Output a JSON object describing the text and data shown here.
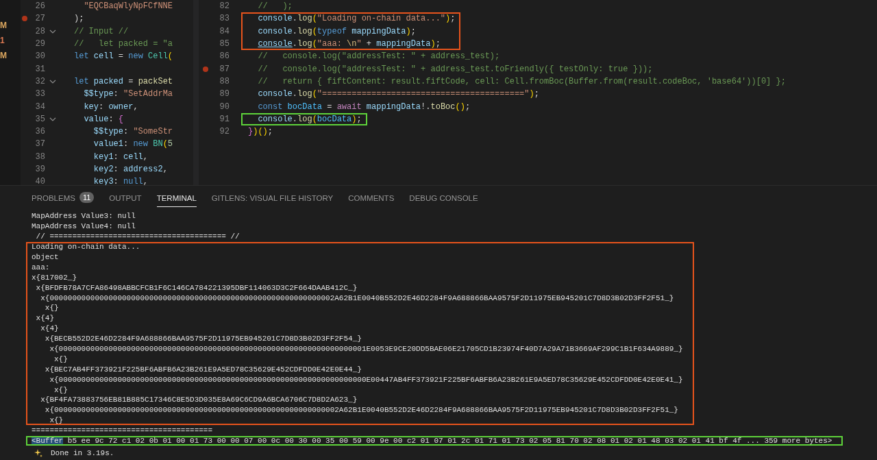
{
  "explorer_badges": [
    {
      "text": "M",
      "color": "#d9a55e"
    },
    {
      "text": "1",
      "color": "#e07b53"
    },
    {
      "text": "M",
      "color": "#d9a55e"
    }
  ],
  "left_editor": {
    "lines": [
      {
        "kind": "line",
        "number": "26",
        "breakpoint": false,
        "tokens": [
          {
            "kind": "str",
            "text": "  \"EQCBaqWlyNpFCfNNE"
          }
        ]
      },
      {
        "kind": "line",
        "number": "27",
        "breakpoint": true,
        "tokens": [
          {
            "kind": "p",
            "text": ");"
          }
        ]
      },
      {
        "kind": "line",
        "number": "28",
        "breakpoint": false,
        "expanded": true,
        "tokens": [
          {
            "kind": "cm",
            "text": "// Input //"
          }
        ]
      },
      {
        "kind": "line",
        "number": "29",
        "breakpoint": false,
        "tokens": [
          {
            "kind": "cm",
            "text": "//   let packed = \"a"
          }
        ]
      },
      {
        "kind": "line",
        "number": "30",
        "breakpoint": false,
        "tokens": [
          {
            "kind": "kw",
            "text": "let"
          },
          {
            "kind": "var",
            "text": " cell"
          },
          {
            "kind": "p",
            "text": " = "
          },
          {
            "kind": "kw",
            "text": "new"
          },
          {
            "kind": "type",
            "text": " Cell"
          },
          {
            "kind": "br",
            "text": "("
          }
        ]
      },
      {
        "kind": "line",
        "number": "31",
        "breakpoint": false
      },
      {
        "kind": "line",
        "number": "32",
        "breakpoint": false,
        "expanded": true,
        "tokens": [
          {
            "kind": "kw",
            "text": "let"
          },
          {
            "kind": "var",
            "text": " packed"
          },
          {
            "kind": "p",
            "text": " = "
          },
          {
            "kind": "fn",
            "text": "packSet"
          }
        ]
      },
      {
        "kind": "line",
        "number": "33",
        "breakpoint": false,
        "tokens": [
          {
            "kind": "var",
            "text": "  $$type"
          },
          {
            "kind": "p",
            "text": ": "
          },
          {
            "kind": "str",
            "text": "\"SetAddrMa"
          }
        ]
      },
      {
        "kind": "line",
        "number": "34",
        "breakpoint": false,
        "tokens": [
          {
            "kind": "var",
            "text": "  key"
          },
          {
            "kind": "p",
            "text": ": "
          },
          {
            "kind": "var",
            "text": "owner"
          },
          {
            "kind": "p",
            "text": ","
          }
        ]
      },
      {
        "kind": "line",
        "number": "35",
        "breakpoint": false,
        "expanded": true,
        "tokens": [
          {
            "kind": "var",
            "text": "  value"
          },
          {
            "kind": "p",
            "text": ": "
          },
          {
            "kind": "br2",
            "text": "{"
          }
        ]
      },
      {
        "kind": "line",
        "number": "36",
        "breakpoint": false,
        "tokens": [
          {
            "kind": "var",
            "text": "    $$type"
          },
          {
            "kind": "p",
            "text": ": "
          },
          {
            "kind": "str",
            "text": "\"SomeStr"
          }
        ]
      },
      {
        "kind": "line",
        "number": "37",
        "breakpoint": false,
        "tokens": [
          {
            "kind": "var",
            "text": "    value1"
          },
          {
            "kind": "p",
            "text": ": "
          },
          {
            "kind": "kw",
            "text": "new"
          },
          {
            "kind": "type",
            "text": " BN"
          },
          {
            "kind": "br",
            "text": "("
          },
          {
            "kind": "num",
            "text": "5"
          }
        ]
      },
      {
        "kind": "line",
        "number": "38",
        "breakpoint": false,
        "tokens": [
          {
            "kind": "var",
            "text": "    key1"
          },
          {
            "kind": "p",
            "text": ": "
          },
          {
            "kind": "var",
            "text": "cell"
          },
          {
            "kind": "p",
            "text": ","
          }
        ]
      },
      {
        "kind": "line",
        "number": "39",
        "breakpoint": false,
        "tokens": [
          {
            "kind": "var",
            "text": "    key2"
          },
          {
            "kind": "p",
            "text": ": "
          },
          {
            "kind": "var",
            "text": "address2"
          },
          {
            "kind": "p",
            "text": ","
          }
        ]
      },
      {
        "kind": "line",
        "number": "40",
        "breakpoint": false,
        "tokens": [
          {
            "kind": "var",
            "text": "    key3"
          },
          {
            "kind": "p",
            "text": ": "
          },
          {
            "kind": "kw",
            "text": "null"
          },
          {
            "kind": "p",
            "text": ","
          }
        ]
      }
    ]
  },
  "right_editor": {
    "lines": [
      {
        "kind": "line",
        "number": "82",
        "breakpoint": false,
        "tokens": [
          {
            "kind": "cm",
            "text": "  //   );"
          }
        ]
      },
      {
        "kind": "annotation",
        "color": "#e8541c",
        "lines": [
          {
            "kind": "line",
            "number": "83",
            "breakpoint": false,
            "tokens": [
              {
                "kind": "var",
                "text": "  console"
              },
              {
                "kind": "p",
                "text": "."
              },
              {
                "kind": "fn",
                "text": "log"
              },
              {
                "kind": "br",
                "text": "("
              },
              {
                "kind": "str",
                "text": "\"Loading on-chain data...\""
              },
              {
                "kind": "br",
                "text": ")"
              },
              {
                "kind": "p",
                "text": ";"
              }
            ]
          },
          {
            "kind": "line",
            "number": "84",
            "breakpoint": false,
            "tokens": [
              {
                "kind": "var",
                "text": "  console"
              },
              {
                "kind": "p",
                "text": "."
              },
              {
                "kind": "fn",
                "text": "log"
              },
              {
                "kind": "br",
                "text": "("
              },
              {
                "kind": "kw",
                "text": "typeof"
              },
              {
                "kind": "var",
                "text": " mappingData"
              },
              {
                "kind": "br",
                "text": ")"
              },
              {
                "kind": "p",
                "text": ";"
              }
            ]
          },
          {
            "kind": "line",
            "number": "85",
            "breakpoint": false,
            "tokens": [
              {
                "kind": "var",
                "text": "  console",
                "underline": true
              },
              {
                "kind": "p",
                "text": "."
              },
              {
                "kind": "fn",
                "text": "log"
              },
              {
                "kind": "br",
                "text": "("
              },
              {
                "kind": "str",
                "text": "\"aaa: "
              },
              {
                "kind": "esc",
                "text": "\\n"
              },
              {
                "kind": "str",
                "text": "\""
              },
              {
                "kind": "p",
                "text": " + "
              },
              {
                "kind": "var",
                "text": "mappingData"
              },
              {
                "kind": "br",
                "text": ")"
              },
              {
                "kind": "p",
                "text": ";"
              }
            ]
          }
        ]
      },
      {
        "kind": "line",
        "number": "86",
        "breakpoint": false,
        "tokens": [
          {
            "kind": "cm",
            "text": "  //   console.log(\"addressTest: \" + address_test);"
          }
        ]
      },
      {
        "kind": "line",
        "number": "87",
        "breakpoint": true,
        "tokens": [
          {
            "kind": "cm",
            "text": "  //   console.log(\"addressTest: \" + address_test.toFriendly({ testOnly: true }));"
          }
        ]
      },
      {
        "kind": "line",
        "number": "88",
        "breakpoint": false,
        "tokens": [
          {
            "kind": "cm",
            "text": "  //   return { fiftContent: result.fiftCode, cell: Cell.fromBoc(Buffer.from(result.codeBoc, 'base64'))[0] };"
          }
        ]
      },
      {
        "kind": "line",
        "number": "89",
        "breakpoint": false,
        "tokens": [
          {
            "kind": "var",
            "text": "  console"
          },
          {
            "kind": "p",
            "text": "."
          },
          {
            "kind": "fn",
            "text": "log"
          },
          {
            "kind": "br",
            "text": "("
          },
          {
            "kind": "str",
            "text": "\"=========================================\""
          },
          {
            "kind": "br",
            "text": ")"
          },
          {
            "kind": "p",
            "text": ";"
          }
        ]
      },
      {
        "kind": "line",
        "number": "90",
        "breakpoint": false,
        "tokens": [
          {
            "kind": "kw",
            "text": "  const"
          },
          {
            "kind": "const",
            "text": " bocData"
          },
          {
            "kind": "p",
            "text": " = "
          },
          {
            "kind": "ctrl",
            "text": "await"
          },
          {
            "kind": "var",
            "text": " mappingData"
          },
          {
            "kind": "p",
            "text": "!."
          },
          {
            "kind": "fn",
            "text": "toBoc"
          },
          {
            "kind": "br",
            "text": "()"
          },
          {
            "kind": "p",
            "text": ";"
          }
        ]
      },
      {
        "kind": "annotation",
        "color": "#5ed33a",
        "lines": [
          {
            "kind": "line",
            "number": "91",
            "breakpoint": false,
            "tokens": [
              {
                "kind": "var",
                "text": "  console"
              },
              {
                "kind": "p",
                "text": "."
              },
              {
                "kind": "fn",
                "text": "log"
              },
              {
                "kind": "br",
                "text": "("
              },
              {
                "kind": "const",
                "text": "bocData"
              },
              {
                "kind": "br",
                "text": ")"
              },
              {
                "kind": "p",
                "text": ";"
              }
            ]
          }
        ]
      },
      {
        "kind": "line",
        "number": "92",
        "breakpoint": false,
        "tokens": [
          {
            "kind": "br2",
            "text": "}"
          },
          {
            "kind": "br",
            "text": ")()"
          },
          {
            "kind": "p",
            "text": ";"
          }
        ]
      }
    ]
  },
  "panel_tabs": [
    {
      "label": "PROBLEMS",
      "badge": "11",
      "selected": false
    },
    {
      "label": "OUTPUT",
      "selected": false
    },
    {
      "label": "TERMINAL",
      "selected": true
    },
    {
      "label": "GITLENS: VISUAL FILE HISTORY",
      "selected": false
    },
    {
      "label": "COMMENTS",
      "selected": false
    },
    {
      "label": "DEBUG CONSOLE",
      "selected": false
    }
  ],
  "terminal": {
    "lines": [
      {
        "kind": "output",
        "text": "MapAddress Value3: null"
      },
      {
        "kind": "output",
        "text": "MapAddress Value4: null"
      },
      {
        "kind": "output",
        "text": " // ======================================= //"
      },
      {
        "kind": "annotation",
        "color": "#e8541c",
        "lines": [
          {
            "kind": "output",
            "text": "Loading on-chain data..."
          },
          {
            "kind": "output",
            "text": "object"
          },
          {
            "kind": "output",
            "text": "aaa:"
          },
          {
            "kind": "output",
            "text": "x{817002_}"
          },
          {
            "kind": "output",
            "text": " x{BFDFB78A7CFA86498ABBCFCB1F6C146CA784221395DBF114063D3C2F664DAAB412C_}"
          },
          {
            "kind": "output",
            "text": "  x{000000000000000000000000000000000000000000000000000000000000002A62B1E0040B552D2E46D2284F9A688866BAA9575F2D11975EB945201C7D8D3B02D3FF2F51_}"
          },
          {
            "kind": "output",
            "text": "   x{}"
          },
          {
            "kind": "output",
            "text": " x{4}"
          },
          {
            "kind": "output",
            "text": "  x{4}"
          },
          {
            "kind": "output",
            "text": "   x{BECB552D2E46D2284F9A688866BAA9575F2D11975EB945201C7D8D3B02D3FF2F54_}"
          },
          {
            "kind": "output",
            "text": "    x{00000000000000000000000000000000000000000000000000000000000000000001E0053E9CE20DD5BAE06E21705CD1B23974F40D7A29A71B3669AF299C1B1F634A9889_}"
          },
          {
            "kind": "output",
            "text": "     x{}"
          },
          {
            "kind": "output",
            "text": "   x{BEC7AB4FF373921F225BF6ABFB6A23B261E9A5ED78C35629E452CDFDD0E42E0E44_}"
          },
          {
            "kind": "output",
            "text": "    x{00000000000000000000000000000000000000000000000000000000000000000000E00447AB4FF373921F225BF6ABFB6A23B261E9A5ED78C35629E452CDFDD0E42E0E41_}"
          },
          {
            "kind": "output",
            "text": "     x{}"
          },
          {
            "kind": "output",
            "text": "  x{BF4FA73883756EB81B885C17346C8E5D3D035E8A69C6CD9A6BCA6706C7D8D2A623_}"
          },
          {
            "kind": "output",
            "text": "   x{000000000000000000000000000000000000000000000000000000000000002A62B1E0040B552D2E46D2284F9A688866BAA9575F2D11975EB945201C7D8D3B02D3FF2F51_}"
          },
          {
            "kind": "output",
            "text": "    x{}"
          }
        ]
      },
      {
        "kind": "output",
        "text": "========================================"
      },
      {
        "kind": "annotation",
        "color": "#5ed33a",
        "lines": [
          {
            "kind": "output",
            "segments": [
              {
                "text": "<Buffer",
                "selected": true
              },
              {
                "text": " b5 ee 9c 72 c1 02 0b 01 00 01 73 00 00 07 00 0c 00 30 00 35 00 59 00 9e 00 c2 01 07 01 2c 01 71 01 73 02 05 81 70 02 08 01 02 01 48 03 02 01 41 bf 4f ... 359 more bytes>",
                "selected": false
              }
            ]
          }
        ]
      },
      {
        "kind": "status",
        "text": "Done in 3.19s."
      }
    ]
  }
}
